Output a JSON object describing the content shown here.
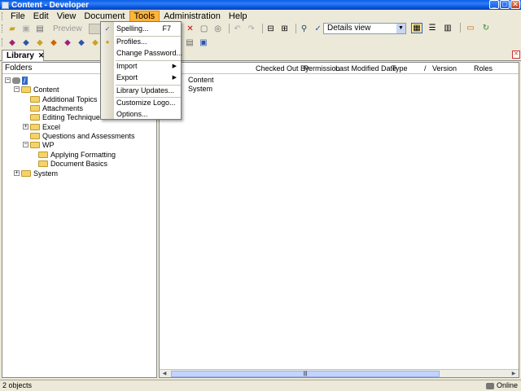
{
  "window": {
    "title": "Content - Developer"
  },
  "menubar": {
    "items": [
      "File",
      "Edit",
      "View",
      "Document",
      "Tools",
      "Administration",
      "Help"
    ],
    "active": "Tools"
  },
  "toolbar": {
    "preview_label": "Preview",
    "view_select_value": "Details view"
  },
  "tab": {
    "label": "Library"
  },
  "folders": {
    "header": "Folders",
    "root_label": "/",
    "items": [
      "Content",
      "Additional Topics",
      "Attachments",
      "Editing Techniques",
      "Excel",
      "Questions and Assessments",
      "WP",
      "Applying Formatting",
      "Document Basics",
      "System"
    ]
  },
  "content": {
    "columns": [
      "Checked Out By",
      "Permission",
      "Last Modified Date",
      "Type",
      "/",
      "Version",
      "Roles"
    ],
    "rows": [
      "Content",
      "System"
    ]
  },
  "tools_menu": {
    "spelling": "Spelling...",
    "spelling_shortcut": "F7",
    "profiles": "Profiles...",
    "change_password": "Change Password...",
    "import": "Import",
    "export": "Export",
    "library_updates": "Library Updates...",
    "customize_logo": "Customize Logo...",
    "options": "Options..."
  },
  "status": {
    "left": "2 objects",
    "right": "Online"
  },
  "colors": {
    "title_bar": "#0a5ee6",
    "menu_active": "#ffb53a",
    "selection": "#3169c6"
  }
}
